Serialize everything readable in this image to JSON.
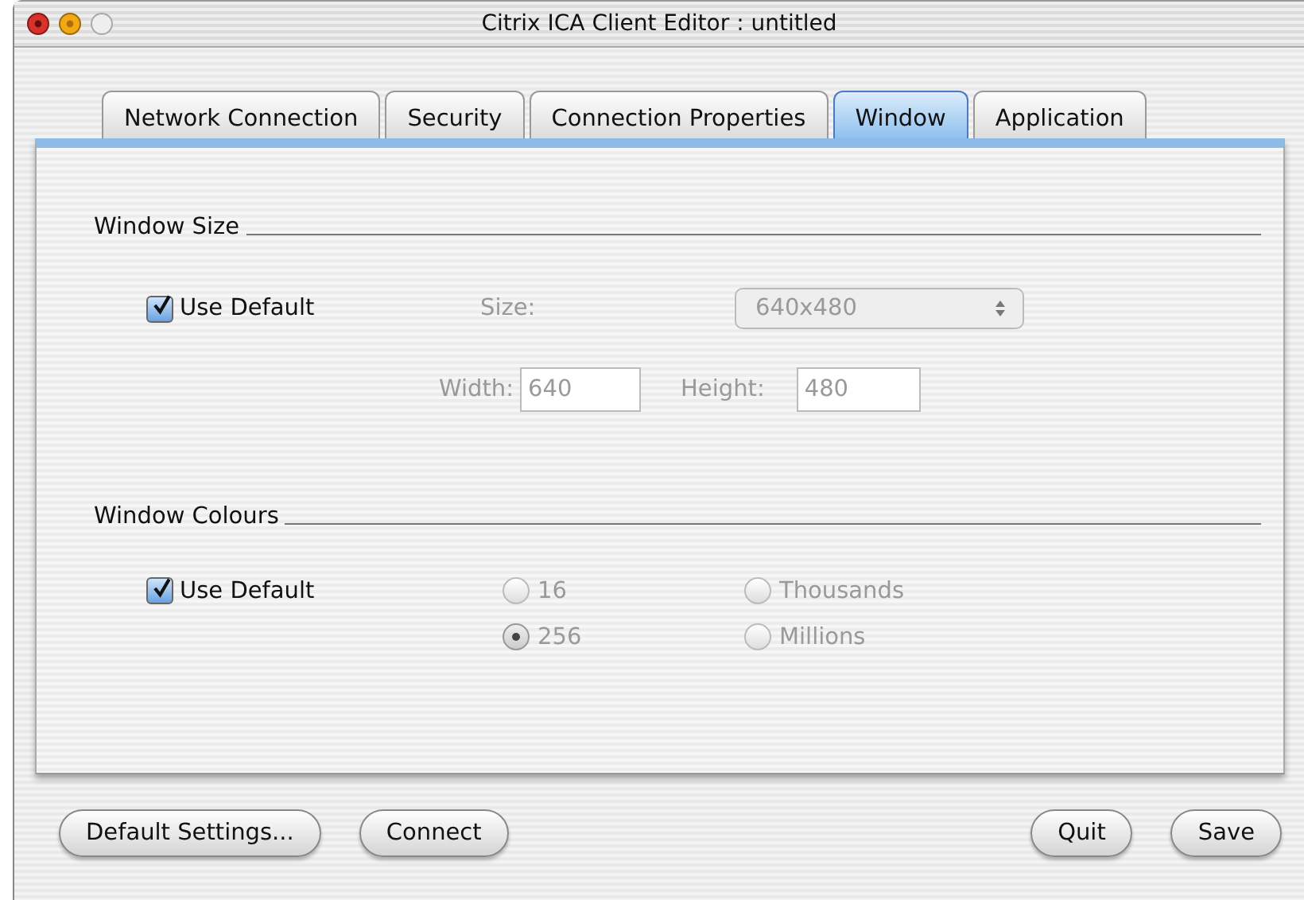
{
  "window": {
    "title": "Citrix ICA Client Editor : untitled"
  },
  "tabs": [
    {
      "label": "Network Connection",
      "selected": false
    },
    {
      "label": "Security",
      "selected": false
    },
    {
      "label": "Connection Properties",
      "selected": false
    },
    {
      "label": "Window",
      "selected": true
    },
    {
      "label": "Application",
      "selected": false
    }
  ],
  "window_size": {
    "title": "Window Size",
    "use_default": {
      "label": "Use Default",
      "checked": true
    },
    "disabled": true,
    "size": {
      "label": "Size:",
      "value": "640x480"
    },
    "width": {
      "label": "Width:",
      "value": "640"
    },
    "height": {
      "label": "Height:",
      "value": "480"
    }
  },
  "window_colours": {
    "title": "Window Colours",
    "use_default": {
      "label": "Use Default",
      "checked": true
    },
    "disabled": true,
    "options": [
      {
        "label": "16",
        "selected": false
      },
      {
        "label": "Thousands",
        "selected": false
      },
      {
        "label": "256",
        "selected": true
      },
      {
        "label": "Millions",
        "selected": false
      }
    ]
  },
  "buttons": [
    {
      "label": "Default Settings..."
    },
    {
      "label": "Connect"
    },
    {
      "label": "Quit"
    },
    {
      "label": "Save"
    }
  ]
}
